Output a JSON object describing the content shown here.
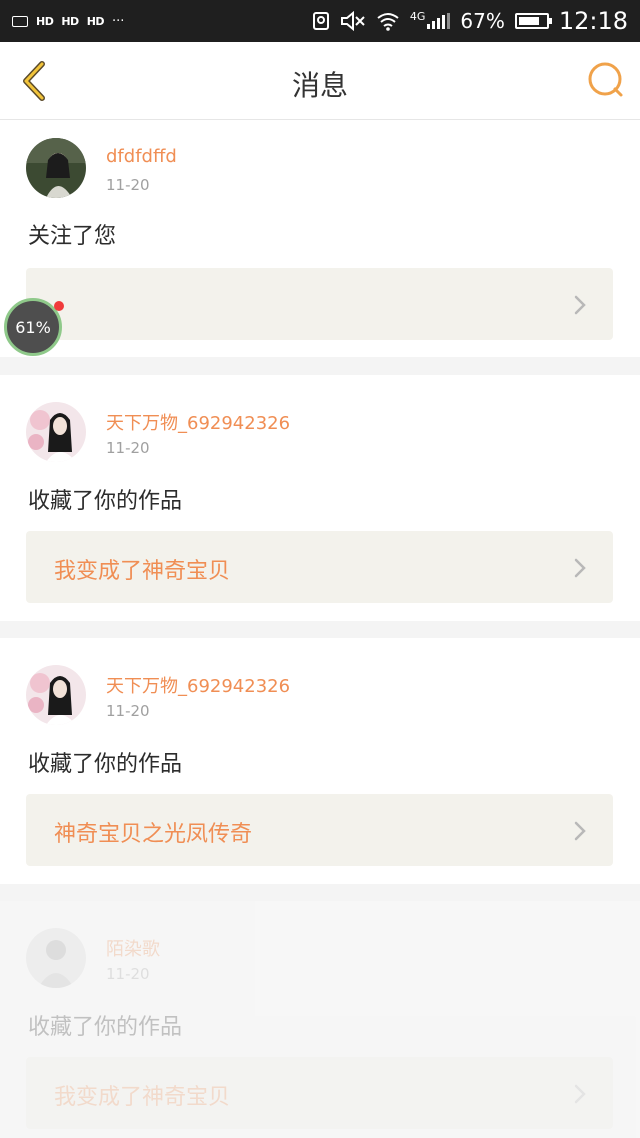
{
  "status_bar": {
    "left_icons": [
      "image-icon",
      "hd-icon",
      "hd-icon",
      "hd-icon"
    ],
    "hd_label": "HD",
    "more": "···",
    "network": "4G",
    "battery_percent": "67%",
    "battery_level": 0.67,
    "time": "12:18"
  },
  "nav": {
    "title": "消息",
    "accent_color": "#f0a24a"
  },
  "floating_widget": {
    "label": "61%"
  },
  "messages": [
    {
      "username": "dfdfdffd",
      "date": "11-20",
      "action": "关注了您",
      "box_text": ""
    },
    {
      "username": "天下万物_692942326",
      "date": "11-20",
      "action": "收藏了你的作品",
      "box_text": "我变成了神奇宝贝"
    },
    {
      "username": "天下万物_692942326",
      "date": "11-20",
      "action": "收藏了你的作品",
      "box_text": "神奇宝贝之光凤传奇"
    },
    {
      "username": "陌染歌",
      "date": "11-20",
      "action": "收藏了你的作品",
      "box_text": "我变成了神奇宝贝"
    }
  ]
}
